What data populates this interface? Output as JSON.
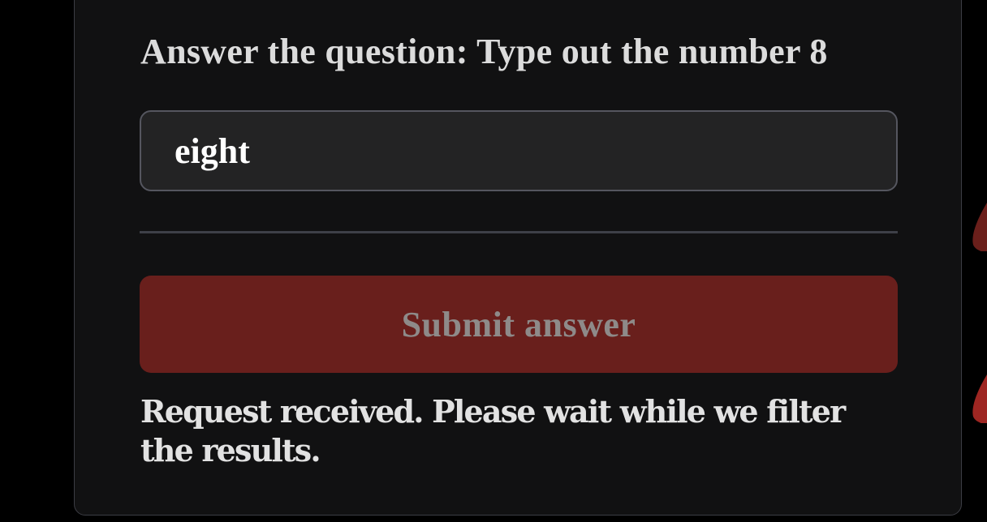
{
  "question": {
    "text": "Answer the question: Type out the number 8"
  },
  "answer_input": {
    "value": "eight"
  },
  "submit": {
    "label": "Submit answer"
  },
  "status": {
    "text": "Request received. Please wait while we filter the results."
  },
  "colors": {
    "background": "#000000",
    "panel": "#111112",
    "button": "#691f1c",
    "accent": "#9e2622"
  }
}
